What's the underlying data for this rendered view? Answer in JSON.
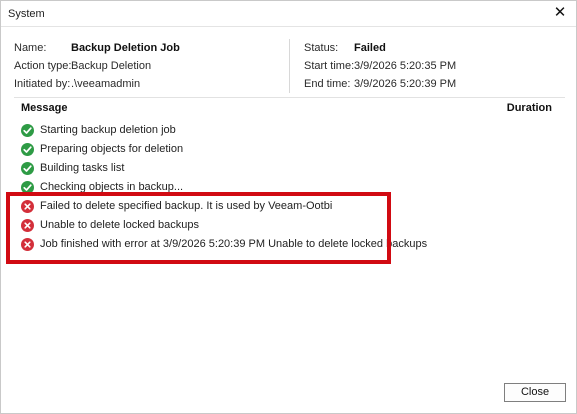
{
  "window": {
    "title": "System"
  },
  "summary": {
    "name_label": "Name:",
    "name_value": "Backup Deletion Job",
    "action_label": "Action type:",
    "action_value": "Backup Deletion",
    "initiated_label": "Initiated by:",
    "initiated_value": ".\\veeamadmin",
    "status_label": "Status:",
    "status_value": "Failed",
    "start_label": "Start time:",
    "start_value": "3/9/2026 5:20:35 PM",
    "end_label": "End time:",
    "end_value": "3/9/2026 5:20:39 PM"
  },
  "log": {
    "col_message": "Message",
    "col_duration": "Duration",
    "items": [
      {
        "status": "success",
        "icon": "check-circle-icon",
        "text": "Starting backup deletion job"
      },
      {
        "status": "success",
        "icon": "check-circle-icon",
        "text": "Preparing objects for deletion"
      },
      {
        "status": "success",
        "icon": "check-circle-icon",
        "text": "Building tasks list"
      },
      {
        "status": "success",
        "icon": "check-circle-icon",
        "text": "Checking objects in backup..."
      },
      {
        "status": "error",
        "icon": "error-circle-icon",
        "text": "Failed to delete specified backup. It is used by Veeam-Ootbi"
      },
      {
        "status": "error",
        "icon": "error-circle-icon",
        "text": "Unable to delete locked backups"
      },
      {
        "status": "error",
        "icon": "error-circle-icon",
        "text": "Job finished with error at 3/9/2026 5:20:39 PM Unable to delete locked backups"
      }
    ]
  },
  "footer": {
    "close_label": "Close"
  },
  "colors": {
    "success": "#2e9b45",
    "error": "#d32f3a",
    "highlight": "#d10a12"
  }
}
